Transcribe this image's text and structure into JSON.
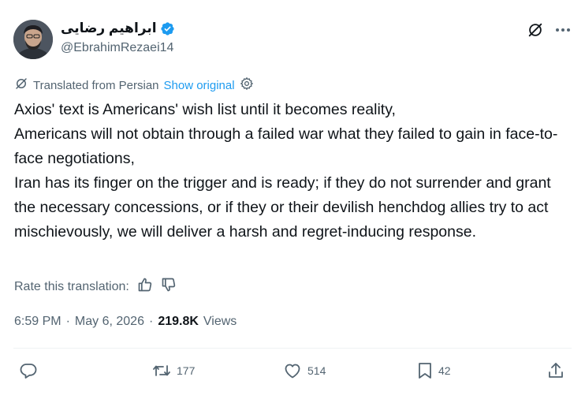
{
  "author": {
    "display_name": "ابراهیم رضایی",
    "handle": "@EbrahimRezaei14",
    "verified": true
  },
  "translation": {
    "label": "Translated from Persian",
    "show_original": "Show original"
  },
  "tweet": {
    "text": "Axios' text is Americans' wish list until it becomes reality,\nAmericans will not obtain through a failed war what they failed to gain in face-to-face negotiations,\nIran has its finger on the trigger and is ready; if they do not surrender and grant the necessary concessions, or if they or their devilish henchdog allies try to act mischievously, we will deliver a harsh and regret-inducing response."
  },
  "rating": {
    "label": "Rate this translation:"
  },
  "meta": {
    "time": "6:59 PM",
    "date": "May 6, 2026",
    "views_count": "219.8K",
    "views_label": "Views",
    "separator": "·"
  },
  "actions": {
    "reposts": "177",
    "likes": "514",
    "bookmarks": "42"
  },
  "colors": {
    "accent": "#1d9bf0",
    "secondary_text": "#536471",
    "primary_text": "#0f1419"
  }
}
